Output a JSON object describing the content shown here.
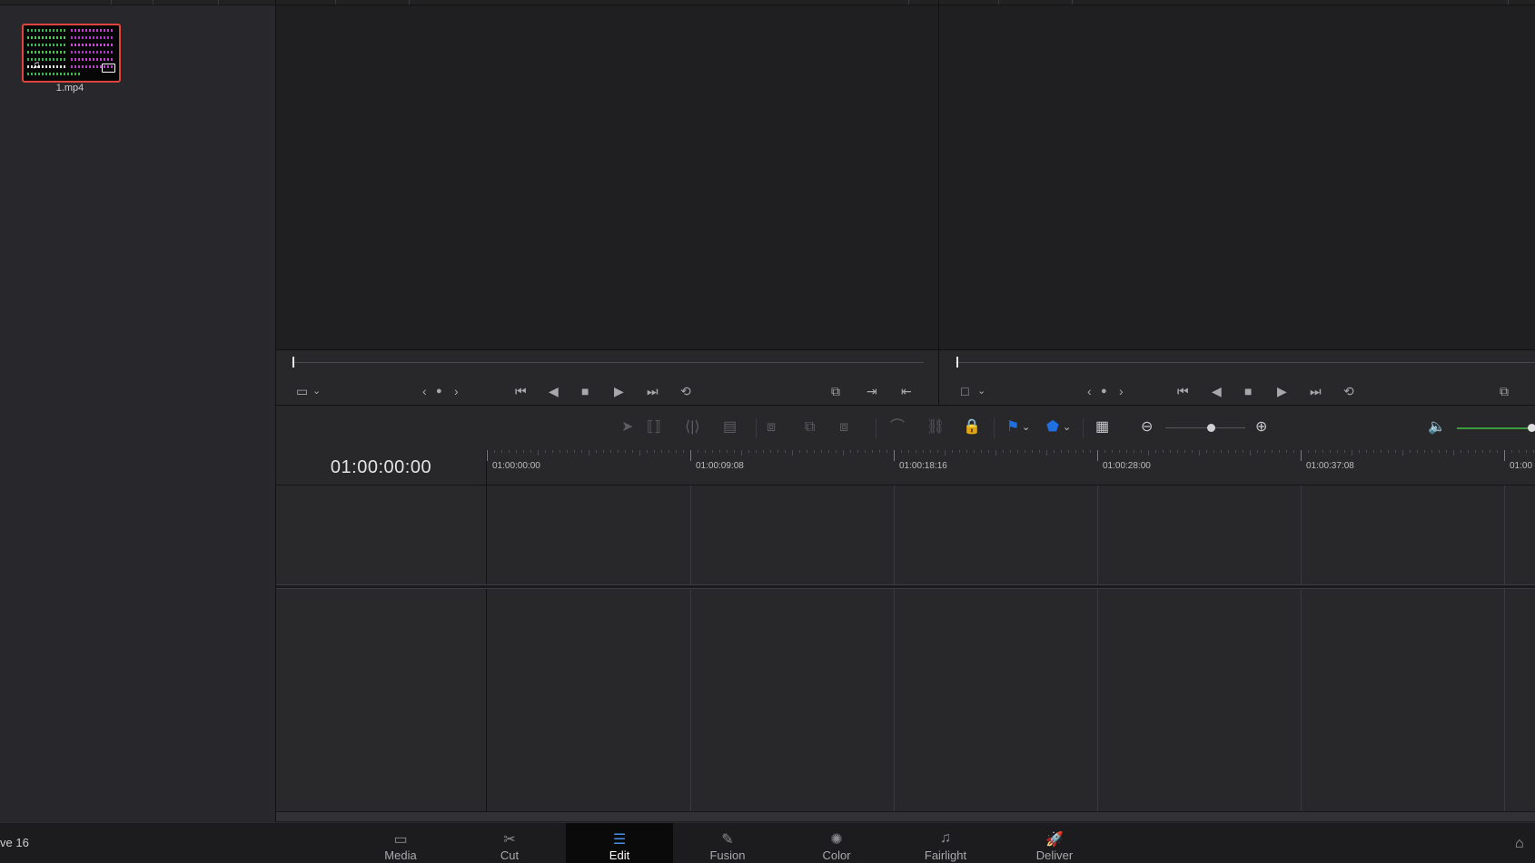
{
  "media_pool": {
    "clips": [
      {
        "name": "1.mp4",
        "selected": true
      }
    ]
  },
  "source_viewer": {
    "controls": [
      "film-frame-icon",
      "chevron-down-icon",
      "prev-icon",
      "dot-icon",
      "next-icon",
      "jump-to-start-icon",
      "reverse-play-icon",
      "stop-icon",
      "play-icon",
      "jump-to-end-icon",
      "loop-icon",
      "match-frame-icon",
      "mark-in-icon",
      "mark-out-icon"
    ]
  },
  "timeline_viewer": {
    "controls": [
      "frame-icon",
      "chevron-down-icon",
      "prev-icon",
      "dot-icon",
      "next-icon",
      "jump-to-start-icon",
      "reverse-play-icon",
      "stop-icon",
      "play-icon",
      "jump-to-end-icon",
      "loop-icon",
      "match-frame-icon"
    ]
  },
  "toolbar": {
    "flag_color": "#1f6fe0",
    "marker_color": "#1f6fe0",
    "volume_color": "#3a9b3e"
  },
  "timeline": {
    "timecode": "01:00:00:00",
    "ruler_labels": [
      "01:00:00:00",
      "01:00:09:08",
      "01:00:18:16",
      "01:00:28:00",
      "01:00:37:08",
      "01:00"
    ]
  },
  "status": {
    "version": "ve 16"
  },
  "pages": [
    {
      "label": "Media",
      "icon": "media-icon",
      "active": false
    },
    {
      "label": "Cut",
      "icon": "cut-icon",
      "active": false
    },
    {
      "label": "Edit",
      "icon": "edit-icon",
      "active": true
    },
    {
      "label": "Fusion",
      "icon": "fusion-icon",
      "active": false
    },
    {
      "label": "Color",
      "icon": "color-icon",
      "active": false
    },
    {
      "label": "Fairlight",
      "icon": "fairlight-icon",
      "active": false
    },
    {
      "label": "Deliver",
      "icon": "deliver-icon",
      "active": false
    }
  ],
  "colors": {
    "accent_selected_clip": "#e0443c",
    "active_tab_icon": "#4a8ee8"
  }
}
